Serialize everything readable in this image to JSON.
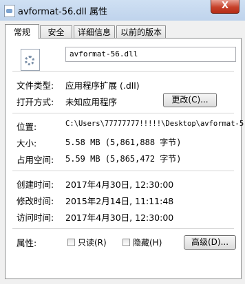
{
  "window": {
    "title": "avformat-56.dll 属性",
    "close_symbol": "X"
  },
  "tabs": [
    {
      "label": "常规",
      "active": true
    },
    {
      "label": "安全",
      "active": false
    },
    {
      "label": "详细信息",
      "active": false
    },
    {
      "label": "以前的版本",
      "active": false
    }
  ],
  "general": {
    "file_name": "avformat-56.dll",
    "file_type": {
      "label": "文件类型:",
      "value": "应用程序扩展 (.dll)"
    },
    "opens_with": {
      "label": "打开方式:",
      "value": "未知应用程序",
      "change_button": "更改(C)..."
    },
    "location": {
      "label": "位置:",
      "value": "C:\\Users\\77777777!!!!!\\Desktop\\avformat-5"
    },
    "size": {
      "label": "大小:",
      "value": "5.58 MB (5,861,888 字节)"
    },
    "size_on_disk": {
      "label": "占用空间:",
      "value": "5.59 MB (5,865,472 字节)"
    },
    "created": {
      "label": "创建时间:",
      "value": "2017年4月30日, 12:30:00"
    },
    "modified": {
      "label": "修改时间:",
      "value": "2015年2月14日, 11:11:48"
    },
    "accessed": {
      "label": "访问时间:",
      "value": "2017年4月30日, 12:30:00"
    },
    "attributes": {
      "label": "属性:",
      "readonly_label": "只读(R)",
      "readonly_checked": false,
      "hidden_label": "隐藏(H)",
      "hidden_checked": false,
      "advanced_button": "高级(D)..."
    }
  },
  "icons": {
    "title_icon": "dll-file-icon",
    "file_icon": "gear-file-icon"
  }
}
